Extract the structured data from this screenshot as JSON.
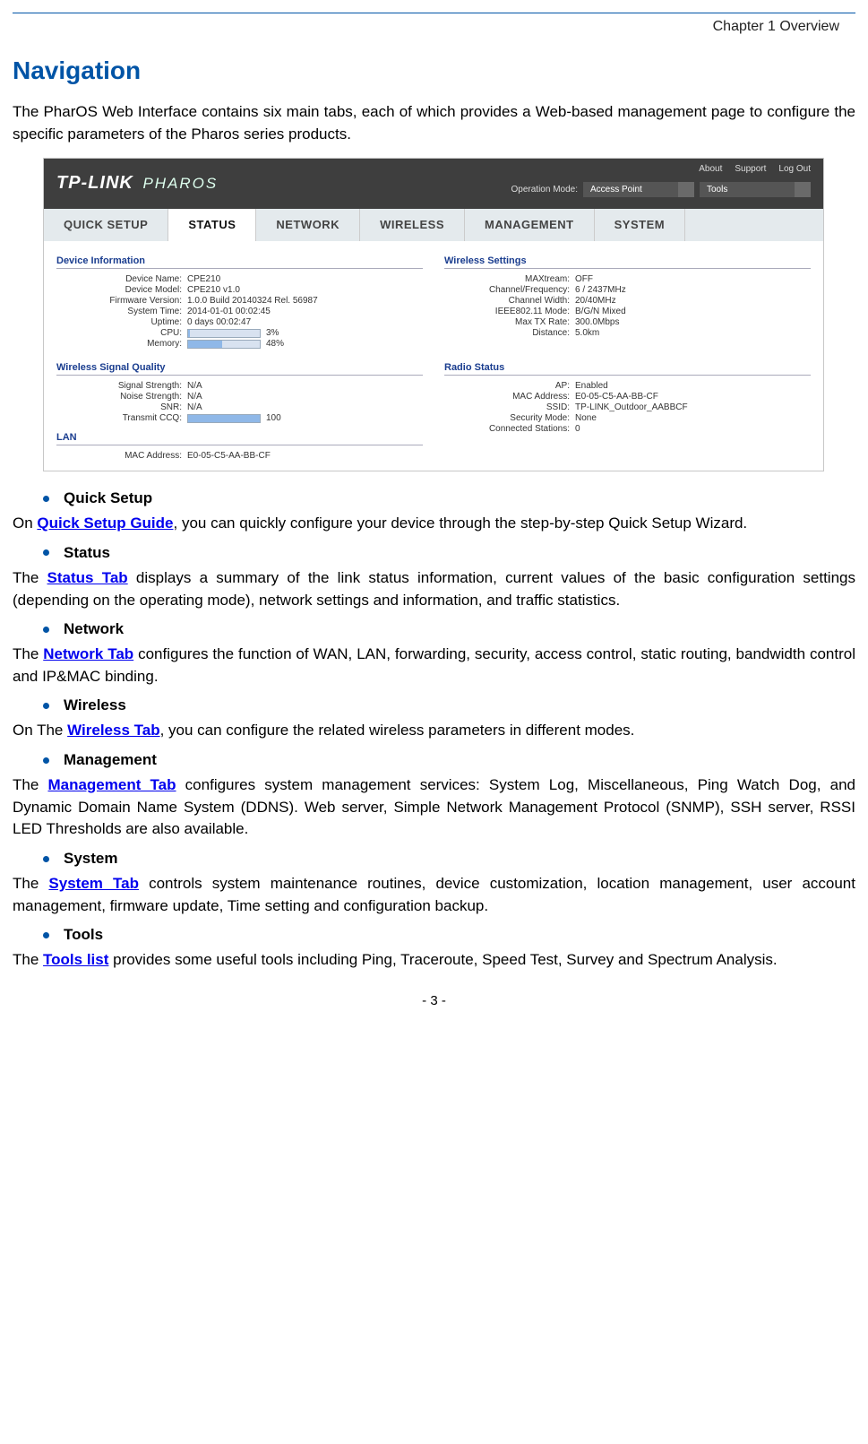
{
  "header": "Chapter 1 Overview",
  "title": "Navigation",
  "intro": "The PharOS Web Interface contains six main tabs, each of which provides a Web-based management page to configure the specific parameters of the Pharos series products.",
  "shot": {
    "logo": "TP-LINK",
    "logo2": "PHAROS",
    "links": {
      "about": "About",
      "support": "Support",
      "logout": "Log Out"
    },
    "opmode_label": "Operation Mode:",
    "opmode": "Access Point",
    "tools": "Tools",
    "tabs": {
      "quick": "QUICK SETUP",
      "status": "STATUS",
      "network": "NETWORK",
      "wireless": "WIRELESS",
      "management": "MANAGEMENT",
      "system": "SYSTEM"
    },
    "dev": {
      "title": "Device Information",
      "name_l": "Device Name:",
      "name": "CPE210",
      "model_l": "Device Model:",
      "model": "CPE210 v1.0",
      "fw_l": "Firmware Version:",
      "fw": "1.0.0 Build 20140324 Rel. 56987",
      "time_l": "System Time:",
      "time": "2014-01-01 00:02:45",
      "up_l": "Uptime:",
      "up": "0 days 00:02:47",
      "cpu_l": "CPU:",
      "cpu": "3%",
      "mem_l": "Memory:",
      "mem": "48%"
    },
    "wset": {
      "title": "Wireless Settings",
      "max_l": "MAXtream:",
      "max": "OFF",
      "ch_l": "Channel/Frequency:",
      "ch": "6 / 2437MHz",
      "cw_l": "Channel Width:",
      "cw": "20/40MHz",
      "mode_l": "IEEE802.11 Mode:",
      "mode": "B/G/N Mixed",
      "tx_l": "Max TX Rate:",
      "tx": "300.0Mbps",
      "dist_l": "Distance:",
      "dist": "5.0km"
    },
    "wsq": {
      "title": "Wireless Signal Quality",
      "sig_l": "Signal Strength:",
      "sig": "N/A",
      "noise_l": "Noise Strength:",
      "noise": "N/A",
      "snr_l": "SNR:",
      "snr": "N/A",
      "ccq_l": "Transmit CCQ:",
      "ccq": "100"
    },
    "radio": {
      "title": "Radio Status",
      "ap_l": "AP:",
      "ap": "Enabled",
      "mac_l": "MAC Address:",
      "mac": "E0-05-C5-AA-BB-CF",
      "ssid_l": "SSID:",
      "ssid": "TP-LINK_Outdoor_AABBCF",
      "sec_l": "Security Mode:",
      "sec": "None",
      "conn_l": "Connected Stations:",
      "conn": "0"
    },
    "lan": {
      "title": "LAN",
      "mac_l": "MAC Address:",
      "mac": "E0-05-C5-AA-BB-CF"
    }
  },
  "sections": {
    "qs": {
      "h": "Quick Setup",
      "pre": "On ",
      "link": "Quick Setup Guide",
      "post": ", you can quickly configure your device through the step-by-step Quick Setup Wizard."
    },
    "st": {
      "h": "Status",
      "pre": "The ",
      "link": "Status Tab",
      "post": " displays a summary of the link status information, current values of the basic configuration settings (depending on the operating mode), network settings and information, and traffic statistics."
    },
    "nw": {
      "h": "Network",
      "pre": "The ",
      "link": "Network Tab",
      "post": " configures the function of WAN, LAN, forwarding, security, access control, static routing, bandwidth control and IP&MAC binding."
    },
    "wl": {
      "h": "Wireless",
      "pre": "On The ",
      "link": "Wireless Tab",
      "post": ", you can configure the related wireless parameters in different modes."
    },
    "mg": {
      "h": "Management",
      "pre": "The ",
      "link": "Management Tab",
      "post": " configures system management services: System Log, Miscellaneous, Ping Watch Dog, and Dynamic Domain Name System (DDNS). Web server, Simple Network Management Protocol (SNMP), SSH server, RSSI LED Thresholds are also available."
    },
    "sy": {
      "h": "System",
      "pre": "The ",
      "link": "System Tab",
      "post": " controls system maintenance routines, device customization, location management, user account management, firmware update, Time setting and configuration backup."
    },
    "tl": {
      "h": "Tools",
      "pre": "The ",
      "link": "Tools list",
      "post": " provides some useful tools including Ping, Traceroute, Speed Test, Survey and Spectrum Analysis."
    }
  },
  "page_no": "- 3 -"
}
